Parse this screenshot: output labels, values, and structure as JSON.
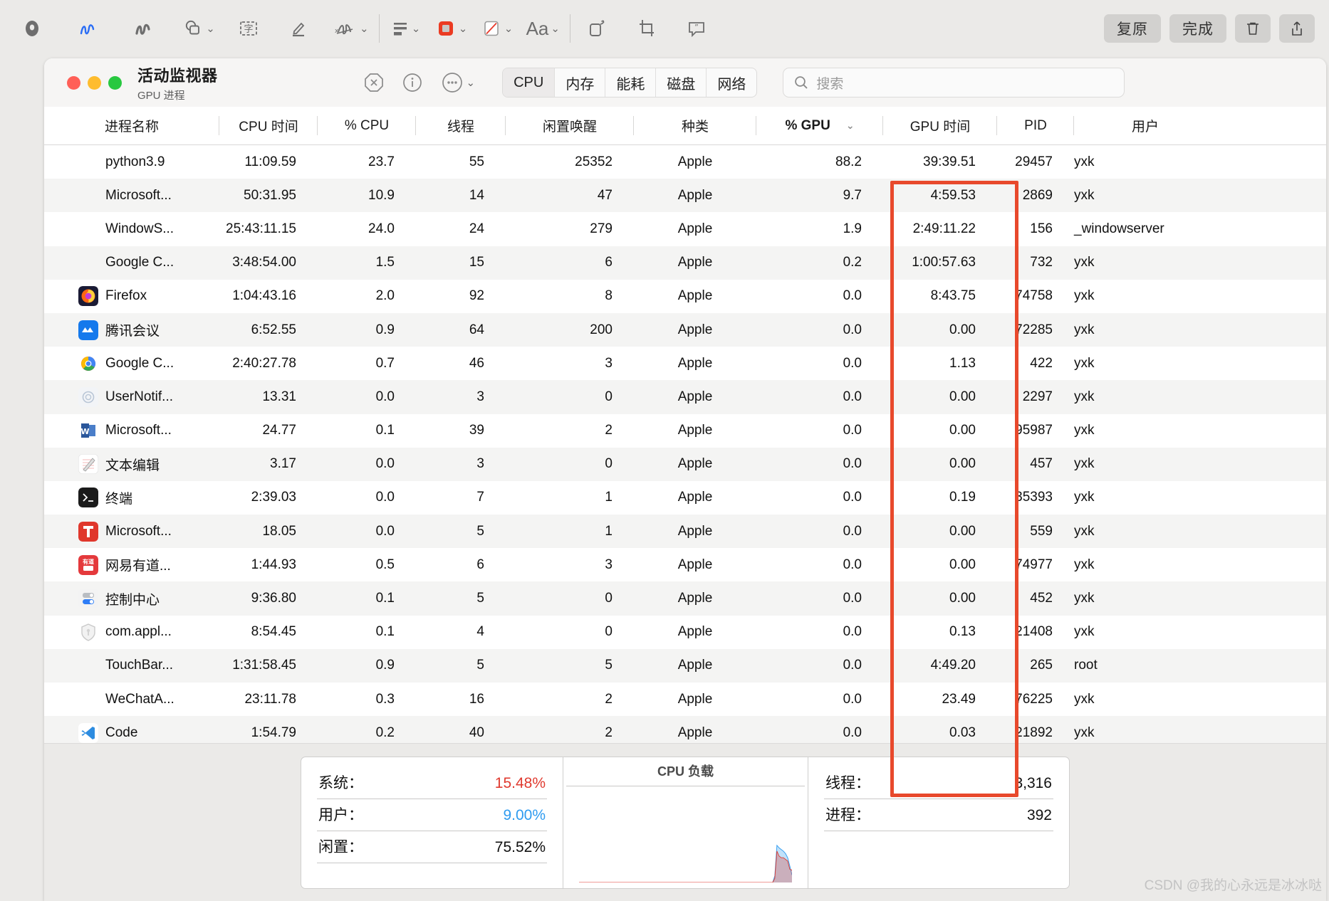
{
  "markup_toolbar": {
    "tools": [
      {
        "name": "instant-alpha-icon",
        "label": "即时 Alpha"
      },
      {
        "name": "sketch-icon",
        "label": "草图"
      },
      {
        "name": "draw-icon",
        "label": "绘图"
      },
      {
        "name": "shapes-icon",
        "label": "形状"
      },
      {
        "name": "text-box-icon",
        "label": "文本"
      },
      {
        "name": "highlight-icon",
        "label": "高亮"
      },
      {
        "name": "signature-icon",
        "label": "签名"
      },
      {
        "name": "shape-style-icon",
        "label": "形状样式"
      },
      {
        "name": "border-color-icon",
        "label": "边框颜色"
      },
      {
        "name": "fill-color-icon",
        "label": "填充颜色"
      },
      {
        "name": "text-style-icon",
        "label": "Aa"
      },
      {
        "name": "rotate-icon",
        "label": "旋转"
      },
      {
        "name": "crop-icon",
        "label": "裁剪"
      },
      {
        "name": "annotate-icon",
        "label": "标注"
      }
    ],
    "undo_label": "复原",
    "done_label": "完成",
    "delete_icon": "trash-icon",
    "share_icon": "share-icon",
    "accent_color": "#e8492c"
  },
  "window": {
    "title": "活动监视器",
    "subtitle": "GPU 进程",
    "traffic_lights": [
      "close",
      "minimize",
      "zoom"
    ],
    "controls": [
      {
        "name": "stop-process-button",
        "icon": "x-octagon-icon"
      },
      {
        "name": "inspect-process-button",
        "icon": "info-circle-icon"
      },
      {
        "name": "more-actions-button",
        "icon": "ellipsis-circle-icon"
      }
    ],
    "tabs": [
      {
        "label": "CPU",
        "active": true
      },
      {
        "label": "内存",
        "active": false
      },
      {
        "label": "能耗",
        "active": false
      },
      {
        "label": "磁盘",
        "active": false
      },
      {
        "label": "网络",
        "active": false
      }
    ],
    "search": {
      "placeholder": "搜索",
      "value": ""
    }
  },
  "table": {
    "columns": [
      {
        "key": "name",
        "label": "进程名称",
        "align": "left",
        "cls": "c-name"
      },
      {
        "key": "cpuT",
        "label": "CPU 时间",
        "align": "num",
        "cls": "c-cpuT"
      },
      {
        "key": "pcpu",
        "label": "% CPU",
        "align": "num",
        "cls": "c-pcpu"
      },
      {
        "key": "thr",
        "label": "线程",
        "align": "num",
        "cls": "c-thr"
      },
      {
        "key": "idle",
        "label": "闲置唤醒",
        "align": "num",
        "cls": "c-idle"
      },
      {
        "key": "kind",
        "label": "种类",
        "align": "ctr",
        "cls": "c-kind"
      },
      {
        "key": "pgpu",
        "label": "% GPU",
        "align": "num",
        "cls": "c-pgpu",
        "sorted": true,
        "sort_icon": "chevron-down-icon"
      },
      {
        "key": "gpuT",
        "label": "GPU 时间",
        "align": "num",
        "cls": "c-gpuT"
      },
      {
        "key": "pid",
        "label": "PID",
        "align": "num",
        "cls": "c-pid"
      },
      {
        "key": "user",
        "label": "用户",
        "align": "lft",
        "cls": "c-user"
      }
    ],
    "highlighted_column": "% GPU",
    "rows": [
      {
        "icon": "none",
        "name": "python3.9",
        "cpuT": "11:09.59",
        "pcpu": "23.7",
        "thr": "55",
        "idle": "25352",
        "kind": "Apple",
        "pgpu": "88.2",
        "gpuT": "39:39.51",
        "pid": "29457",
        "user": "yxk"
      },
      {
        "icon": "none",
        "name": "Microsoft...",
        "cpuT": "50:31.95",
        "pcpu": "10.9",
        "thr": "14",
        "idle": "47",
        "kind": "Apple",
        "pgpu": "9.7",
        "gpuT": "4:59.53",
        "pid": "2869",
        "user": "yxk"
      },
      {
        "icon": "none",
        "name": "WindowS...",
        "cpuT": "25:43:11.15",
        "pcpu": "24.0",
        "thr": "24",
        "idle": "279",
        "kind": "Apple",
        "pgpu": "1.9",
        "gpuT": "2:49:11.22",
        "pid": "156",
        "user": "_windowserver"
      },
      {
        "icon": "none",
        "name": "Google C...",
        "cpuT": "3:48:54.00",
        "pcpu": "1.5",
        "thr": "15",
        "idle": "6",
        "kind": "Apple",
        "pgpu": "0.2",
        "gpuT": "1:00:57.63",
        "pid": "732",
        "user": "yxk"
      },
      {
        "icon": "firefox",
        "name": "Firefox",
        "cpuT": "1:04:43.16",
        "pcpu": "2.0",
        "thr": "92",
        "idle": "8",
        "kind": "Apple",
        "pgpu": "0.0",
        "gpuT": "8:43.75",
        "pid": "74758",
        "user": "yxk"
      },
      {
        "icon": "tencent",
        "name": "腾讯会议",
        "cpuT": "6:52.55",
        "pcpu": "0.9",
        "thr": "64",
        "idle": "200",
        "kind": "Apple",
        "pgpu": "0.0",
        "gpuT": "0.00",
        "pid": "72285",
        "user": "yxk"
      },
      {
        "icon": "chrome",
        "name": "Google C...",
        "cpuT": "2:40:27.78",
        "pcpu": "0.7",
        "thr": "46",
        "idle": "3",
        "kind": "Apple",
        "pgpu": "0.0",
        "gpuT": "1.13",
        "pid": "422",
        "user": "yxk"
      },
      {
        "icon": "usernotif",
        "name": "UserNotif...",
        "cpuT": "13.31",
        "pcpu": "0.0",
        "thr": "3",
        "idle": "0",
        "kind": "Apple",
        "pgpu": "0.0",
        "gpuT": "0.00",
        "pid": "2297",
        "user": "yxk"
      },
      {
        "icon": "word",
        "name": "Microsoft...",
        "cpuT": "24.77",
        "pcpu": "0.1",
        "thr": "39",
        "idle": "2",
        "kind": "Apple",
        "pgpu": "0.0",
        "gpuT": "0.00",
        "pid": "95987",
        "user": "yxk"
      },
      {
        "icon": "textedit",
        "name": "文本编辑",
        "cpuT": "3.17",
        "pcpu": "0.0",
        "thr": "3",
        "idle": "0",
        "kind": "Apple",
        "pgpu": "0.0",
        "gpuT": "0.00",
        "pid": "457",
        "user": "yxk"
      },
      {
        "icon": "terminal",
        "name": "终端",
        "cpuT": "2:39.03",
        "pcpu": "0.0",
        "thr": "7",
        "idle": "1",
        "kind": "Apple",
        "pgpu": "0.0",
        "gpuT": "0.19",
        "pid": "35393",
        "user": "yxk"
      },
      {
        "icon": "teams",
        "name": "Microsoft...",
        "cpuT": "18.05",
        "pcpu": "0.0",
        "thr": "5",
        "idle": "1",
        "kind": "Apple",
        "pgpu": "0.0",
        "gpuT": "0.00",
        "pid": "559",
        "user": "yxk"
      },
      {
        "icon": "youdao",
        "name": "网易有道...",
        "cpuT": "1:44.93",
        "pcpu": "0.5",
        "thr": "6",
        "idle": "3",
        "kind": "Apple",
        "pgpu": "0.0",
        "gpuT": "0.00",
        "pid": "74977",
        "user": "yxk"
      },
      {
        "icon": "control",
        "name": "控制中心",
        "cpuT": "9:36.80",
        "pcpu": "0.1",
        "thr": "5",
        "idle": "0",
        "kind": "Apple",
        "pgpu": "0.0",
        "gpuT": "0.00",
        "pid": "452",
        "user": "yxk"
      },
      {
        "icon": "shield",
        "name": "com.appl...",
        "cpuT": "8:54.45",
        "pcpu": "0.1",
        "thr": "4",
        "idle": "0",
        "kind": "Apple",
        "pgpu": "0.0",
        "gpuT": "0.13",
        "pid": "21408",
        "user": "yxk"
      },
      {
        "icon": "none",
        "name": "TouchBar...",
        "cpuT": "1:31:58.45",
        "pcpu": "0.9",
        "thr": "5",
        "idle": "5",
        "kind": "Apple",
        "pgpu": "0.0",
        "gpuT": "4:49.20",
        "pid": "265",
        "user": "root"
      },
      {
        "icon": "none",
        "name": "WeChatA...",
        "cpuT": "23:11.78",
        "pcpu": "0.3",
        "thr": "16",
        "idle": "2",
        "kind": "Apple",
        "pgpu": "0.0",
        "gpuT": "23.49",
        "pid": "76225",
        "user": "yxk"
      },
      {
        "icon": "vscode",
        "name": "Code",
        "cpuT": "1:54.79",
        "pcpu": "0.2",
        "thr": "40",
        "idle": "2",
        "kind": "Apple",
        "pgpu": "0.0",
        "gpuT": "0.03",
        "pid": "21892",
        "user": "yxk"
      }
    ]
  },
  "summary": {
    "cpu_stats": [
      {
        "label": "系统：",
        "value": "15.48%",
        "color": "#e03a2f"
      },
      {
        "label": "用户：",
        "value": "9.00%",
        "color": "#2e9bf0"
      },
      {
        "label": "闲置：",
        "value": "75.52%",
        "color": "#111111"
      }
    ],
    "graph_title": "CPU 负载",
    "counts": [
      {
        "label": "线程：",
        "value": "3,316"
      },
      {
        "label": "进程：",
        "value": "392"
      }
    ]
  },
  "chart_data": {
    "type": "area",
    "title": "CPU 负载",
    "xlabel": "",
    "ylabel": "",
    "ylim": [
      0,
      100
    ],
    "series": [
      {
        "name": "系统",
        "color": "#e03a2f",
        "values": [
          0,
          0,
          0,
          0,
          0,
          0,
          0,
          0,
          0,
          0,
          0,
          0,
          0,
          0,
          0,
          0,
          0,
          0,
          0,
          0,
          0,
          0,
          0,
          0,
          0,
          0,
          0,
          0,
          0,
          0,
          0,
          0,
          0,
          0,
          0,
          0,
          0,
          0,
          0,
          0,
          0,
          0,
          0,
          0,
          0,
          0,
          0,
          0,
          0,
          0,
          0,
          0,
          0,
          0,
          0,
          0,
          0,
          0,
          0,
          0,
          0,
          0,
          0,
          0,
          0,
          0,
          0,
          0,
          0,
          0,
          0,
          0,
          0,
          0,
          0,
          0,
          0,
          0,
          0,
          0,
          0,
          0,
          0,
          0,
          0,
          0,
          0,
          0,
          0,
          0,
          0,
          5,
          38,
          32,
          30,
          30,
          28,
          26,
          16,
          15
        ]
      },
      {
        "name": "用户",
        "color": "#2e9bf0",
        "values": [
          0,
          0,
          0,
          0,
          0,
          0,
          0,
          0,
          0,
          0,
          0,
          0,
          0,
          0,
          0,
          0,
          0,
          0,
          0,
          0,
          0,
          0,
          0,
          0,
          0,
          0,
          0,
          0,
          0,
          0,
          0,
          0,
          0,
          0,
          0,
          0,
          0,
          0,
          0,
          0,
          0,
          0,
          0,
          0,
          0,
          0,
          0,
          0,
          0,
          0,
          0,
          0,
          0,
          0,
          0,
          0,
          0,
          0,
          0,
          0,
          0,
          0,
          0,
          0,
          0,
          0,
          0,
          0,
          0,
          0,
          0,
          0,
          0,
          0,
          0,
          0,
          0,
          0,
          0,
          0,
          0,
          0,
          0,
          0,
          0,
          0,
          0,
          0,
          0,
          0,
          0,
          8,
          45,
          42,
          40,
          38,
          35,
          30,
          20,
          9
        ]
      }
    ],
    "legend": [
      "系统",
      "用户"
    ],
    "grid": false
  },
  "watermark": "CSDN @我的心永远是冰冰哒"
}
